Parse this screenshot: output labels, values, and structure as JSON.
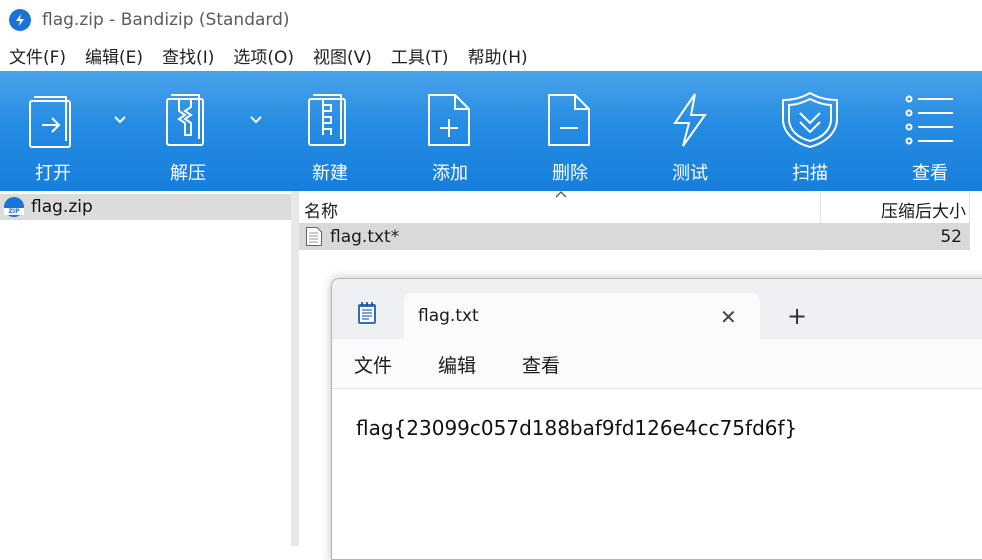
{
  "window": {
    "title": "flag.zip - Bandizip (Standard)",
    "accent": "#1a73d6"
  },
  "menu": [
    "文件(F)",
    "编辑(E)",
    "查找(I)",
    "选项(O)",
    "视图(V)",
    "工具(T)",
    "帮助(H)"
  ],
  "toolbar": {
    "open": "打开",
    "extract": "解压",
    "new": "新建",
    "add": "添加",
    "delete": "删除",
    "test": "测试",
    "scan": "扫描",
    "view": "查看",
    "bg_color": "#258ce3"
  },
  "tree": {
    "archive": "flag.zip",
    "icon_label": "ZIP"
  },
  "filelist": {
    "col_name": "名称",
    "col_size": "压缩后大小",
    "rows": [
      {
        "name": "flag.txt*",
        "size": "52"
      }
    ]
  },
  "notepad": {
    "tab_title": "flag.txt",
    "new_tab": "+",
    "close": "✕",
    "menu": [
      "文件",
      "编辑",
      "查看"
    ],
    "content": "flag{23099c057d188baf9fd126e4cc75fd6f}"
  }
}
